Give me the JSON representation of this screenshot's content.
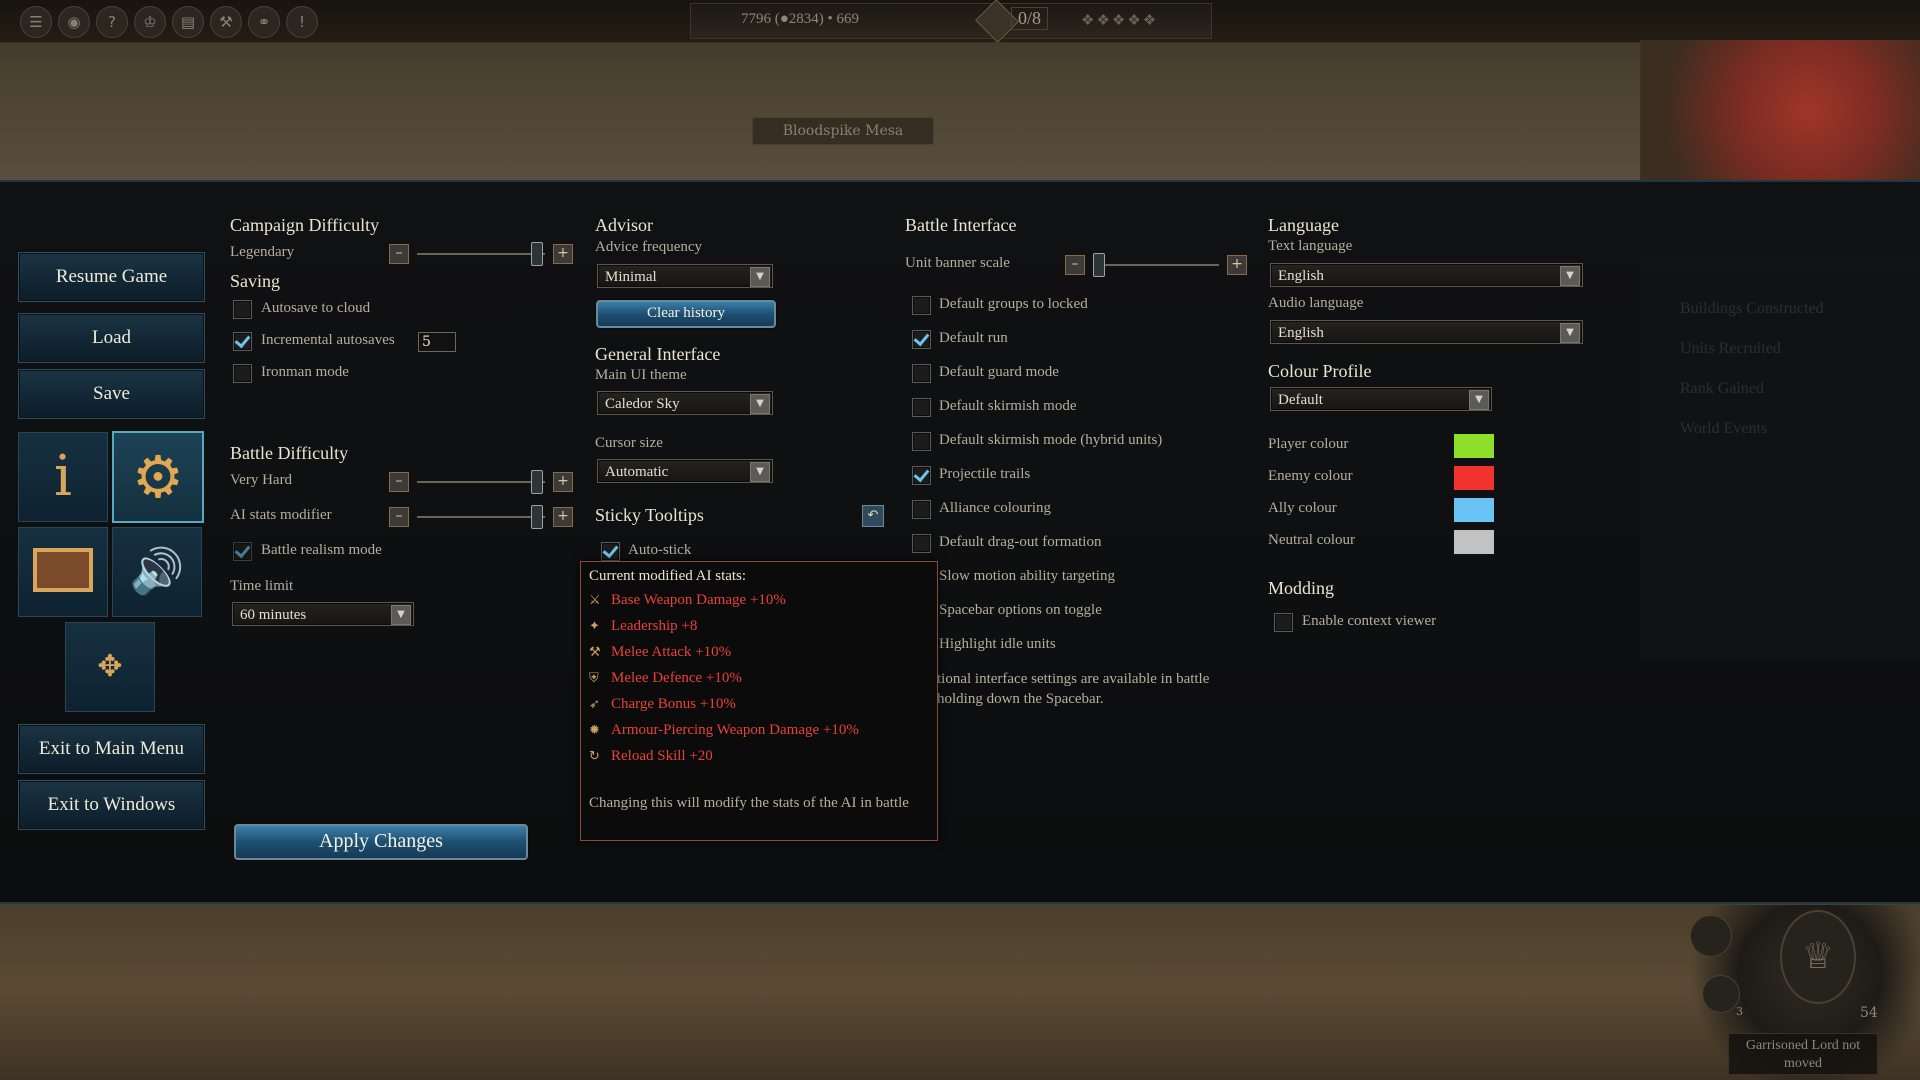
{
  "topbar": {
    "resources_text": "7796 (●2834) • 669",
    "turn_counter": "0/8",
    "icons": [
      "menu-icon",
      "globe-icon",
      "help-icon",
      "crest-icon",
      "book-icon",
      "tools-icon",
      "link-icon",
      "alert-icon"
    ]
  },
  "map_location_label": "Bloodspike Mesa",
  "menu": {
    "resume": "Resume Game",
    "load": "Load",
    "save": "Save",
    "exit_main": "Exit to Main Menu",
    "exit_windows": "Exit to Windows"
  },
  "campaign": {
    "heading": "Campaign Difficulty",
    "value": "Legendary",
    "level_fraction": 1.0
  },
  "saving": {
    "heading": "Saving",
    "autosave_cloud": {
      "label": "Autosave to cloud",
      "checked": false
    },
    "incremental": {
      "label": "Incremental autosaves",
      "checked": true,
      "count": "5"
    },
    "ironman": {
      "label": "Ironman mode",
      "checked": false
    }
  },
  "battle": {
    "heading": "Battle Difficulty",
    "difficulty_value": "Very Hard",
    "difficulty_fraction": 1.0,
    "ai_stats_label": "AI stats modifier",
    "ai_stats_fraction": 1.0,
    "realism": {
      "label": "Battle realism mode",
      "checked": true
    },
    "time_limit_label": "Time limit",
    "time_limit_value": "60 minutes"
  },
  "apply_label": "Apply Changes",
  "advisor": {
    "heading": "Advisor",
    "freq_label": "Advice frequency",
    "freq_value": "Minimal",
    "clear_history": "Clear history"
  },
  "general": {
    "heading": "General Interface",
    "theme_label": "Main UI theme",
    "theme_value": "Caledor Sky",
    "cursor_label": "Cursor size",
    "cursor_value": "Automatic"
  },
  "sticky": {
    "heading": "Sticky Tooltips",
    "auto_stick": {
      "label": "Auto-stick",
      "checked": true
    }
  },
  "tooltip": {
    "title": "Current modified AI stats:",
    "rows": [
      {
        "icon": "weapon-damage-icon",
        "glyph": "⚔",
        "text": "Base Weapon Damage +10%"
      },
      {
        "icon": "leadership-icon",
        "glyph": "✦",
        "text": "Leadership +8"
      },
      {
        "icon": "melee-attack-icon",
        "glyph": "⚒",
        "text": "Melee Attack +10%"
      },
      {
        "icon": "melee-defence-icon",
        "glyph": "⛨",
        "text": "Melee Defence +10%"
      },
      {
        "icon": "charge-bonus-icon",
        "glyph": "➶",
        "text": "Charge Bonus +10%"
      },
      {
        "icon": "armour-piercing-icon",
        "glyph": "✹",
        "text": "Armour-Piercing Weapon Damage +10%"
      },
      {
        "icon": "reload-skill-icon",
        "glyph": "↻",
        "text": "Reload Skill +20"
      }
    ],
    "footer": "Changing this will modify the stats of the AI in battle"
  },
  "battle_interface": {
    "heading": "Battle Interface",
    "banner_label": "Unit banner scale",
    "banner_fraction": 0.1,
    "options": [
      {
        "label": "Default groups to locked",
        "checked": false,
        "show_box": true
      },
      {
        "label": "Default run",
        "checked": true,
        "show_box": true
      },
      {
        "label": "Default guard mode",
        "checked": false,
        "show_box": true
      },
      {
        "label": "Default skirmish mode",
        "checked": false,
        "show_box": true
      },
      {
        "label": "Default skirmish mode (hybrid units)",
        "checked": false,
        "show_box": true
      },
      {
        "label": "Projectile trails",
        "checked": true,
        "show_box": true
      },
      {
        "label": "Alliance colouring",
        "checked": false,
        "show_box": true
      },
      {
        "label": "Default drag-out formation",
        "checked": false,
        "show_box": true
      },
      {
        "label": "Slow motion ability targeting",
        "checked": false,
        "show_box": false
      },
      {
        "label": "Spacebar options on toggle",
        "checked": false,
        "show_box": false
      },
      {
        "label": "Highlight idle units",
        "checked": false,
        "show_box": false
      }
    ],
    "note_line1": "tional interface settings are available in battle",
    "note_line2": "holding down the Spacebar."
  },
  "language": {
    "heading": "Language",
    "text_label": "Text language",
    "text_value": "English",
    "audio_label": "Audio language",
    "audio_value": "English"
  },
  "colour": {
    "heading": "Colour Profile",
    "profile_value": "Default",
    "player_label": "Player colour",
    "player_color": "#8ee02a",
    "enemy_label": "Enemy colour",
    "enemy_color": "#f0332e",
    "ally_label": "Ally colour",
    "ally_color": "#69c3f5",
    "neutral_label": "Neutral colour",
    "neutral_color": "#c2c2c2"
  },
  "modding": {
    "heading": "Modding",
    "context_viewer": {
      "label": "Enable context viewer",
      "checked": false
    }
  },
  "hud": {
    "status": "Garrisoned Lord not moved",
    "count_a": "54",
    "count_b": "3"
  },
  "right_panel_faded": [
    "Buildings Constructed",
    "Units Recruited",
    "Rank Gained",
    "World Events"
  ]
}
